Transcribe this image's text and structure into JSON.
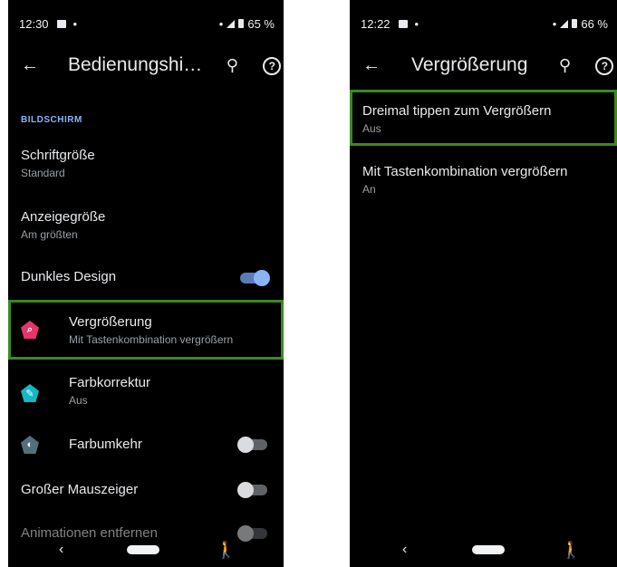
{
  "left": {
    "status": {
      "time": "12:30",
      "battery": "65 %"
    },
    "appbar": {
      "title": "Bedienungshi…"
    },
    "section_header": "BILDSCHIRM",
    "items": [
      {
        "title": "Schriftgröße",
        "subtitle": "Standard"
      },
      {
        "title": "Anzeigegröße",
        "subtitle": "Am größten"
      },
      {
        "title": "Dunkles Design",
        "toggle": "on"
      },
      {
        "title": "Vergrößerung",
        "subtitle": "Mit Tastenkombination vergrößern",
        "icon": "magnify-icon",
        "icon_color": "#e8336b"
      },
      {
        "title": "Farbkorrektur",
        "subtitle": "Aus",
        "icon": "pencil-icon",
        "icon_color": "#14b8c4"
      },
      {
        "title": "Farbumkehr",
        "icon": "invert-icon",
        "icon_color": "#546e7a",
        "toggle": "off"
      },
      {
        "title": "Großer Mauszeiger",
        "toggle": "off"
      },
      {
        "title": "Animationen entfernen",
        "toggle": "off"
      }
    ]
  },
  "right": {
    "status": {
      "time": "12:22",
      "battery": "66 %"
    },
    "appbar": {
      "title": "Vergrößerung"
    },
    "items": [
      {
        "title": "Dreimal tippen zum Vergrößern",
        "subtitle": "Aus"
      },
      {
        "title": "Mit Tastenkombination vergrößern",
        "subtitle": "An"
      }
    ]
  },
  "icons": {
    "back": "←",
    "search": "⚲",
    "help": "?",
    "nav_back": "‹",
    "accessibility": "🚶"
  },
  "colors": {
    "accent": "#8ab4f8",
    "highlight": "#3a8a1f",
    "background": "#000000"
  }
}
